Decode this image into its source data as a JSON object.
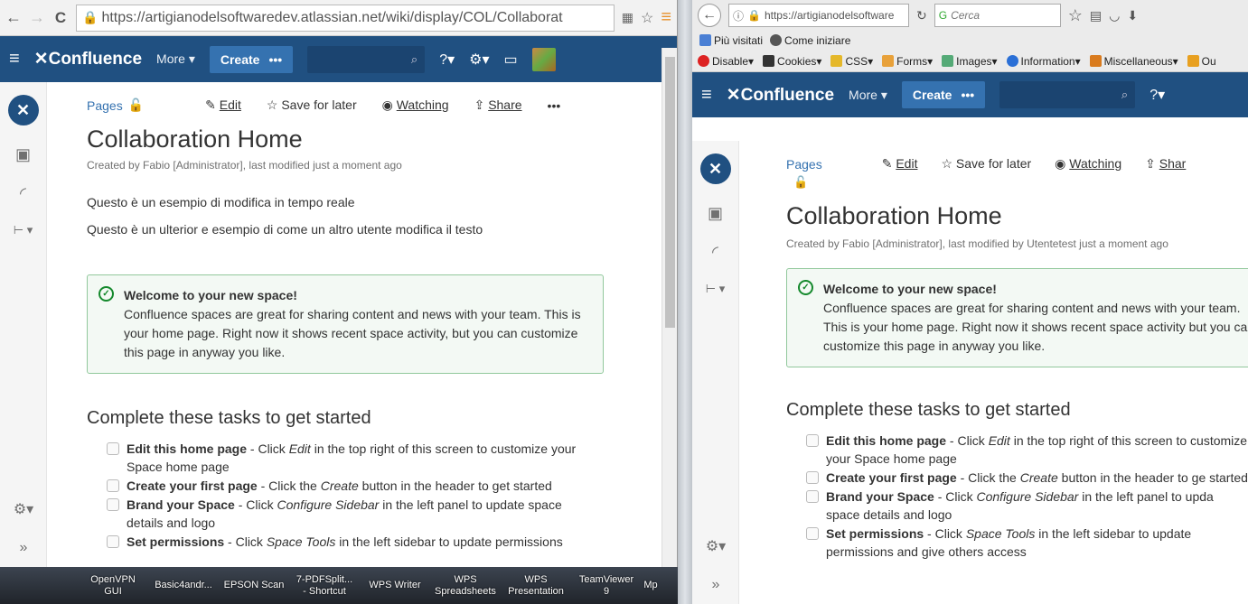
{
  "left": {
    "url": "https://artigianodelsoftwaredev.atlassian.net/wiki/display/COL/Collaborat",
    "header": {
      "logo": "✕Confluence",
      "more": "More ▾",
      "create": "Create",
      "dots": "•••"
    },
    "topbar": {
      "pages": "Pages",
      "edit": "Edit",
      "save": "Save for later",
      "watching": "Watching",
      "share": "Share",
      "more": "•••"
    },
    "title": "Collaboration Home",
    "byline": "Created by Fabio [Administrator], last modified just a moment ago",
    "para1": "Questo è un esempio di modifica in tempo reale",
    "para2": "Questo è un ulterior e esempio di come un altro utente modifica il testo",
    "tip": {
      "title": "Welcome to your new space!",
      "body": "Confluence spaces are great for sharing content and news with your team. This is your home page. Right now it shows recent space activity, but you can customize this page in anyway you like."
    },
    "tasks_heading": "Complete these tasks to get started",
    "tasks": [
      {
        "bold": "Edit this home page",
        "pre": " - Click ",
        "ital": "Edit",
        "post": " in the top right of this screen to customize your Space home page"
      },
      {
        "bold": "Create your first page",
        "pre": " - Click the ",
        "ital": "Create",
        "post": " button in the header to get started"
      },
      {
        "bold": "Brand your Space",
        "pre": " - Click ",
        "ital": "Configure Sidebar",
        "post": " in the left panel to update space details and logo"
      },
      {
        "bold": "Set permissions",
        "pre": " - Click ",
        "ital": "Space Tools",
        "post": " in the left sidebar to update permissions"
      }
    ]
  },
  "right": {
    "url": "https://artigianodelsoftware",
    "search_placeholder": "Cerca",
    "bookmarks1": [
      "Più visitati",
      "Come iniziare"
    ],
    "bookmarks2": [
      "Disable▾",
      "Cookies▾",
      "CSS▾",
      "Forms▾",
      "Images▾",
      "Information▾",
      "Miscellaneous▾",
      "Ou"
    ],
    "header": {
      "logo": "✕Confluence",
      "more": "More ▾",
      "create": "Create",
      "dots": "•••"
    },
    "topbar": {
      "pages": "Pages",
      "edit": "Edit",
      "save": "Save for later",
      "watching": "Watching",
      "share": "Shar"
    },
    "title": "Collaboration Home",
    "byline": "Created by Fabio [Administrator], last modified by Utentetest just a moment ago",
    "tip": {
      "title": "Welcome to your new space!",
      "body": "Confluence spaces are great for sharing content and news with your team. This is your home page. Right now it shows recent space activity but you can customize this page in anyway you like."
    },
    "tasks_heading": "Complete these tasks to get started",
    "tasks": [
      {
        "bold": "Edit this home page",
        "pre": " - Click ",
        "ital": "Edit",
        "post": " in the top right of this screen to customize your Space home page"
      },
      {
        "bold": "Create your first page",
        "pre": " - Click the ",
        "ital": "Create",
        "post": " button in the header to ge started"
      },
      {
        "bold": "Brand your Space",
        "pre": " - Click ",
        "ital": "Configure Sidebar",
        "post": " in the left panel to upda space details and logo"
      },
      {
        "bold": "Set permissions",
        "pre": " - Click ",
        "ital": "Space Tools",
        "post": " in the left sidebar to update permissions and give others access"
      }
    ]
  },
  "taskbar": [
    "OpenVPN\nGUI",
    "Basic4andr...",
    "EPSON Scan",
    "7-PDFSplit...\n- Shortcut",
    "WPS Writer",
    "WPS\nSpreadsheets",
    "WPS\nPresentation",
    "TeamViewer\n9",
    "Mp"
  ]
}
